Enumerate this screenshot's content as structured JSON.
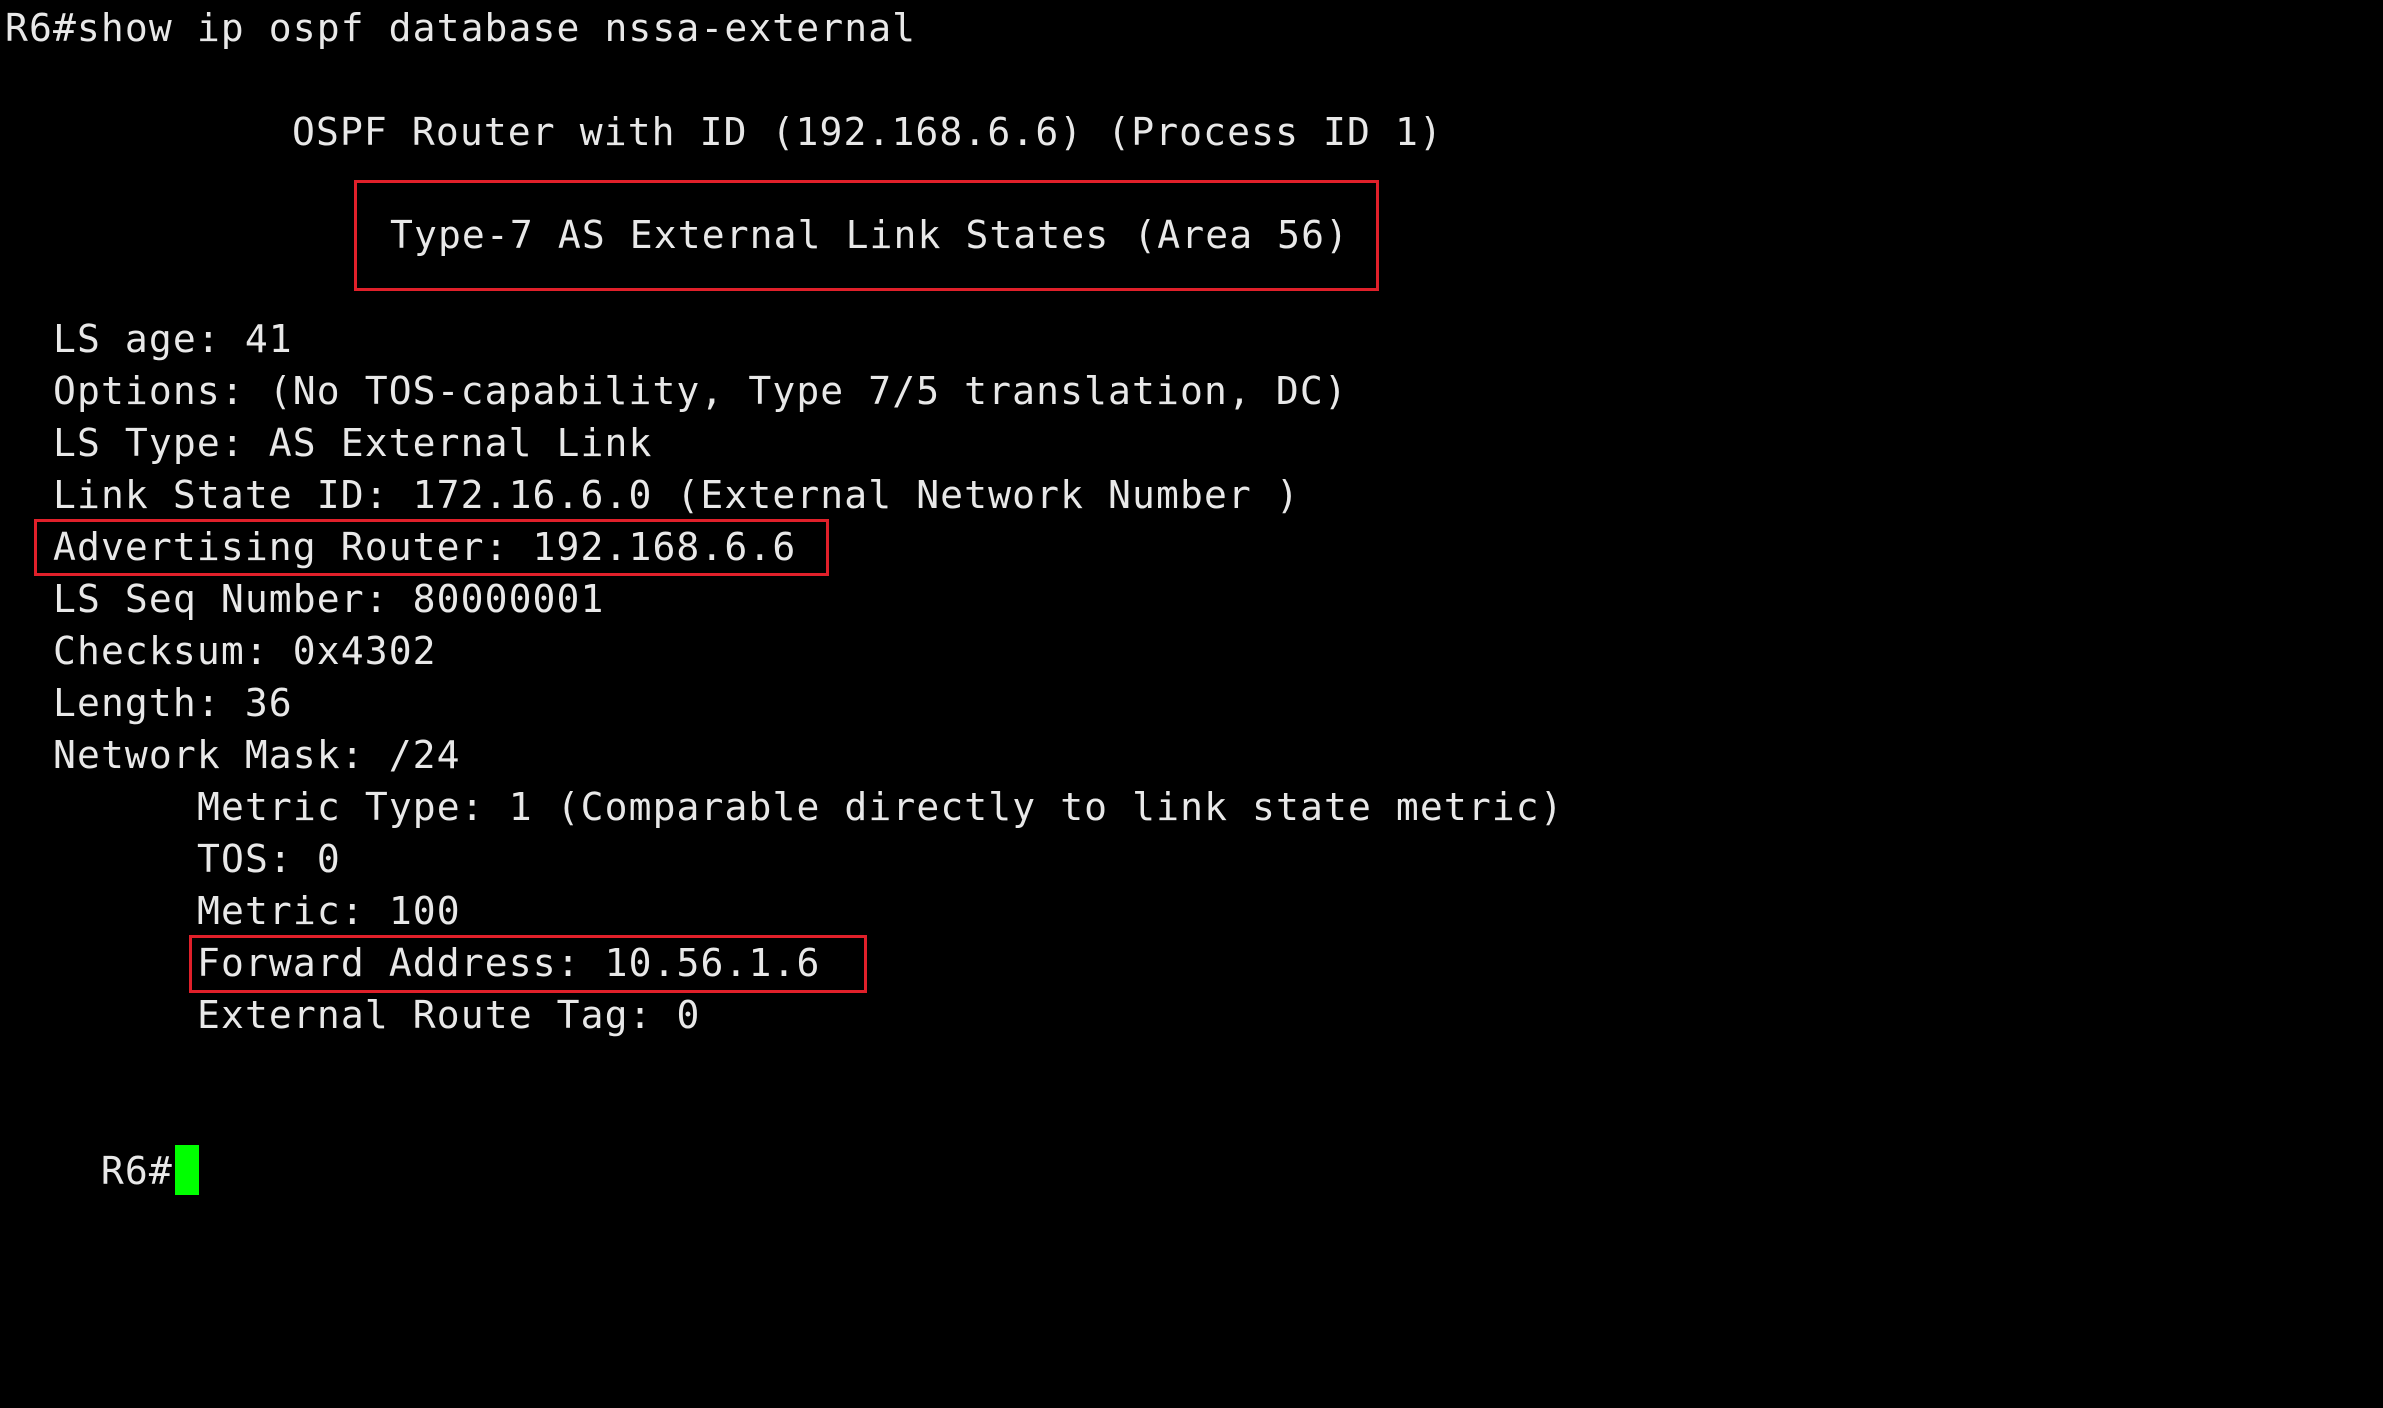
{
  "terminal": {
    "command_line": "R6#show ip ospf database nssa-external",
    "router_header": "OSPF Router with ID (192.168.6.6) (Process ID 1)",
    "section_header": "Type-7 AS External Link States (Area 56)",
    "lsa": {
      "ls_age": "LS age: 41",
      "options": "Options: (No TOS-capability, Type 7/5 translation, DC)",
      "ls_type": "LS Type: AS External Link",
      "link_state_id": "Link State ID: 172.16.6.0 (External Network Number )",
      "advertising_router": "Advertising Router: 192.168.6.6",
      "ls_seq_number": "LS Seq Number: 80000001",
      "checksum": "Checksum: 0x4302",
      "length": "Length: 36",
      "network_mask": "Network Mask: /24",
      "metric_type": "Metric Type: 1 (Comparable directly to link state metric)",
      "tos": "TOS: 0",
      "metric": "Metric: 100",
      "forward_address": "Forward Address: 10.56.1.6",
      "external_route_tag": "External Route Tag: 0"
    },
    "prompt": "R6#"
  },
  "colors": {
    "background": "#000000",
    "text": "#e8e8e8",
    "highlight_box": "#e0202a",
    "cursor": "#00ff00"
  }
}
